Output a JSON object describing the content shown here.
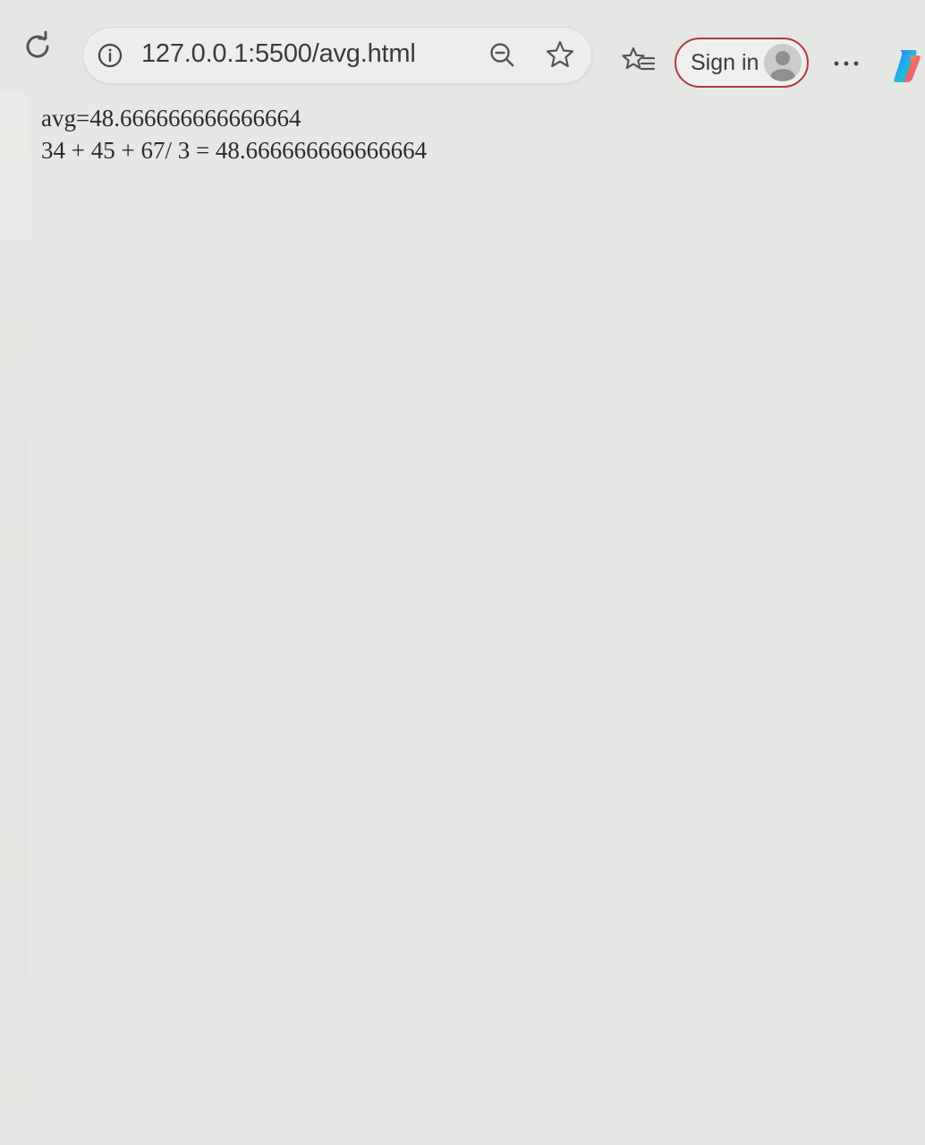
{
  "browser": {
    "address_bar": {
      "url": "127.0.0.1:5500/avg.html"
    },
    "toolbar": {
      "sign_in_label": "Sign in",
      "more_label": "···"
    },
    "icons": {
      "reload": "reload-icon",
      "site_info": "info-icon",
      "zoom": "zoom-out-icon",
      "favorite": "star-icon",
      "favorites_list": "favorites-icon",
      "profile": "avatar-icon",
      "copilot": "copilot-icon"
    },
    "colors": {
      "sign_in_border": "#b3393a",
      "background": "#e6e8e5"
    }
  },
  "page": {
    "lines": [
      "avg=48.666666666666664",
      "34 + 45 + 67/ 3 = 48.666666666666664"
    ]
  }
}
